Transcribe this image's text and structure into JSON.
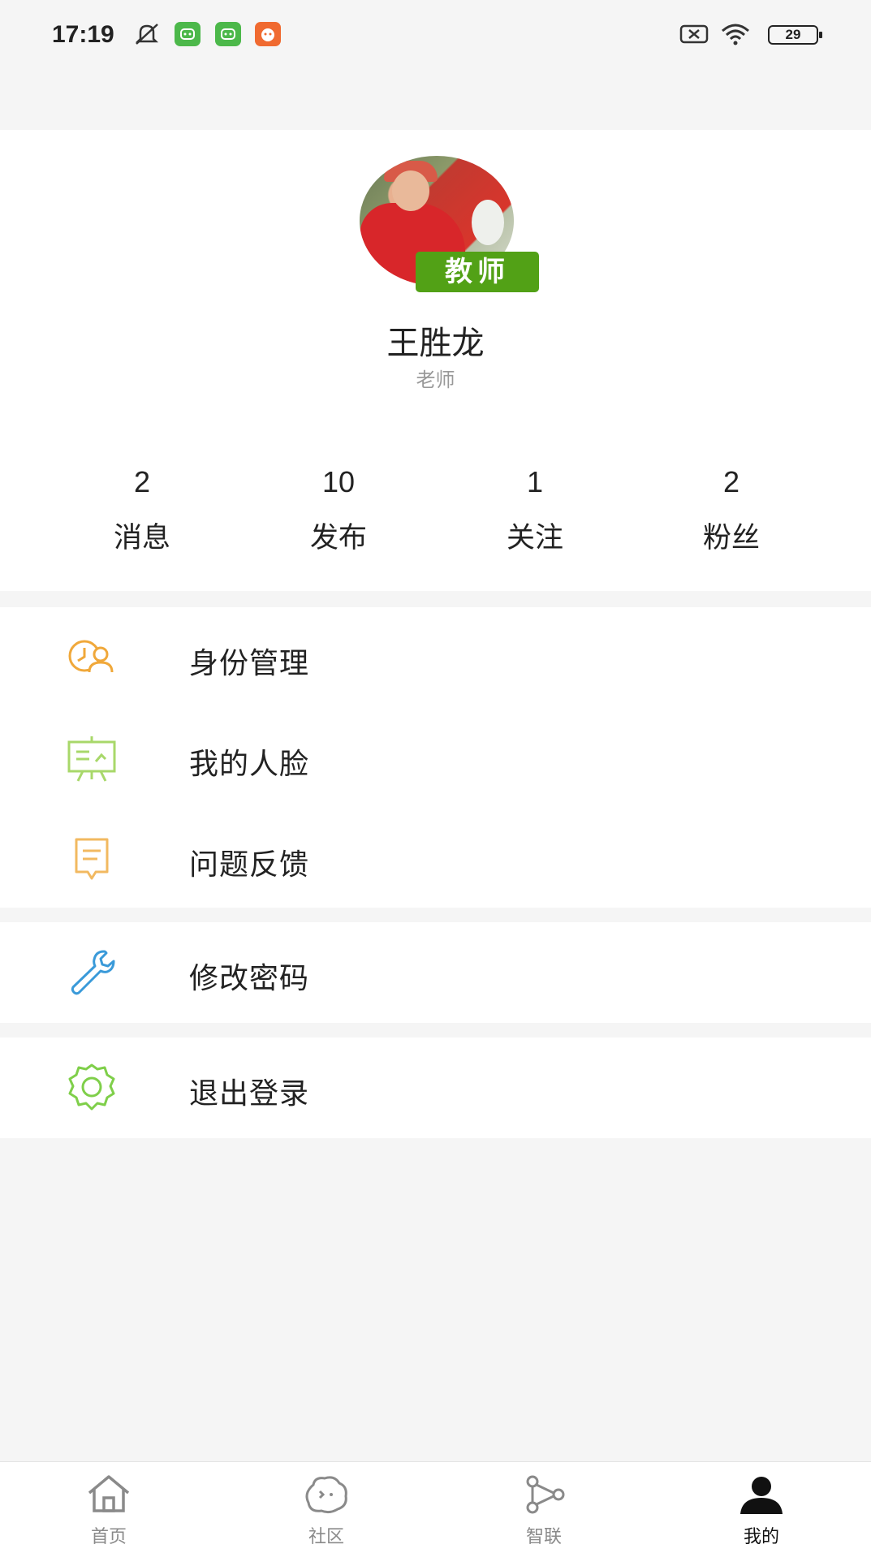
{
  "status_bar": {
    "time": "17:19",
    "battery": "29"
  },
  "profile": {
    "role_tag": "教师",
    "name": "王胜龙",
    "role": "老师",
    "stats": [
      {
        "value": "2",
        "label": "消息"
      },
      {
        "value": "10",
        "label": "发布"
      },
      {
        "value": "1",
        "label": "关注"
      },
      {
        "value": "2",
        "label": "粉丝"
      }
    ]
  },
  "menu": {
    "identity": "身份管理",
    "face": "我的人脸",
    "feedback": "问题反馈",
    "password": "修改密码",
    "logout": "退出登录"
  },
  "bottom_nav": [
    {
      "label": "首页",
      "icon": "home-icon"
    },
    {
      "label": "社区",
      "icon": "community-icon"
    },
    {
      "label": "智联",
      "icon": "share-nodes-icon"
    },
    {
      "label": "我的",
      "icon": "user-icon",
      "active": true
    }
  ],
  "colors": {
    "accent_green": "#52a116",
    "orange_icon": "#f0a83a",
    "green_icon": "#7fcf4a",
    "blue_icon": "#3a9ad9"
  }
}
